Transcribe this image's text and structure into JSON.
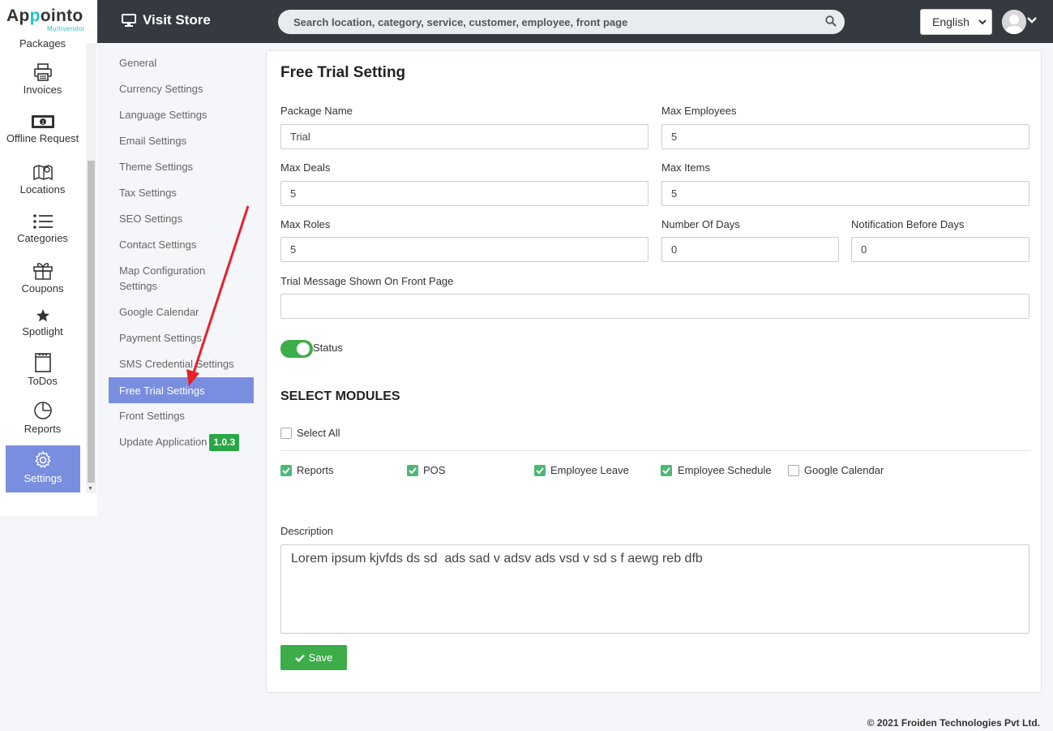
{
  "brand": {
    "name_pre": "Ap",
    "name_highlight": "p",
    "name_post": "ointo",
    "sub": "Multivendor"
  },
  "header": {
    "visit_store": "Visit Store",
    "search_placeholder": "Search location, category, service, customer, employee, front page",
    "language": "English"
  },
  "sidebar": {
    "items": [
      {
        "label": "Packages",
        "icon": "package-icon"
      },
      {
        "label": "Invoices",
        "icon": "printer-icon"
      },
      {
        "label": "Offline Request",
        "icon": "money-icon"
      },
      {
        "label": "Locations",
        "icon": "map-icon"
      },
      {
        "label": "Categories",
        "icon": "list-icon"
      },
      {
        "label": "Coupons",
        "icon": "gift-icon"
      },
      {
        "label": "Spotlight",
        "icon": "star-icon"
      },
      {
        "label": "ToDos",
        "icon": "notepad-icon"
      },
      {
        "label": "Reports",
        "icon": "pie-chart-icon"
      },
      {
        "label": "Settings",
        "icon": "gear-icon",
        "active": true
      }
    ]
  },
  "settings_menu": {
    "items": [
      "General",
      "Currency Settings",
      "Language Settings",
      "Email Settings",
      "Theme Settings",
      "Tax Settings",
      "SEO Settings",
      "Contact Settings",
      "Map Configuration Settings",
      "Google Calendar",
      "Payment Settings",
      "SMS Credential Settings",
      "Free Trial Settings",
      "Front Settings",
      "Update Application"
    ],
    "active_index": 12,
    "version_badge": "1.0.3"
  },
  "form": {
    "title": "Free Trial Setting",
    "package_name": {
      "label": "Package Name",
      "value": "Trial"
    },
    "max_employees": {
      "label": "Max Employees",
      "value": "5"
    },
    "max_deals": {
      "label": "Max Deals",
      "value": "5"
    },
    "max_items": {
      "label": "Max Items",
      "value": "5"
    },
    "max_roles": {
      "label": "Max Roles",
      "value": "5"
    },
    "number_of_days": {
      "label": "Number Of Days",
      "value": "0"
    },
    "notification_before_days": {
      "label": "Notification Before Days",
      "value": "0"
    },
    "trial_message": {
      "label": "Trial Message Shown On Front Page",
      "value": ""
    },
    "status": {
      "label": "Status",
      "on": true
    },
    "modules_title": "SELECT MODULES",
    "select_all": {
      "label": "Select All",
      "checked": false
    },
    "modules": [
      {
        "label": "Reports",
        "checked": true
      },
      {
        "label": "POS",
        "checked": true
      },
      {
        "label": "Employee Leave",
        "checked": true
      },
      {
        "label": "Employee Schedule",
        "checked": true
      },
      {
        "label": "Google Calendar",
        "checked": false
      }
    ],
    "description": {
      "label": "Description",
      "value": "Lorem ipsum kjvfds ds sd  ads sad v adsv ads vsd v sd s f aewg reb dfb"
    },
    "save_label": "Save"
  },
  "footer": {
    "copyright": "© 2021 Froiden Technologies Pvt Ltd."
  },
  "colors": {
    "accent": "#7a8ee0",
    "success": "#3cad49",
    "topbar": "#343a40",
    "annotation_arrow": "#e8202a"
  }
}
